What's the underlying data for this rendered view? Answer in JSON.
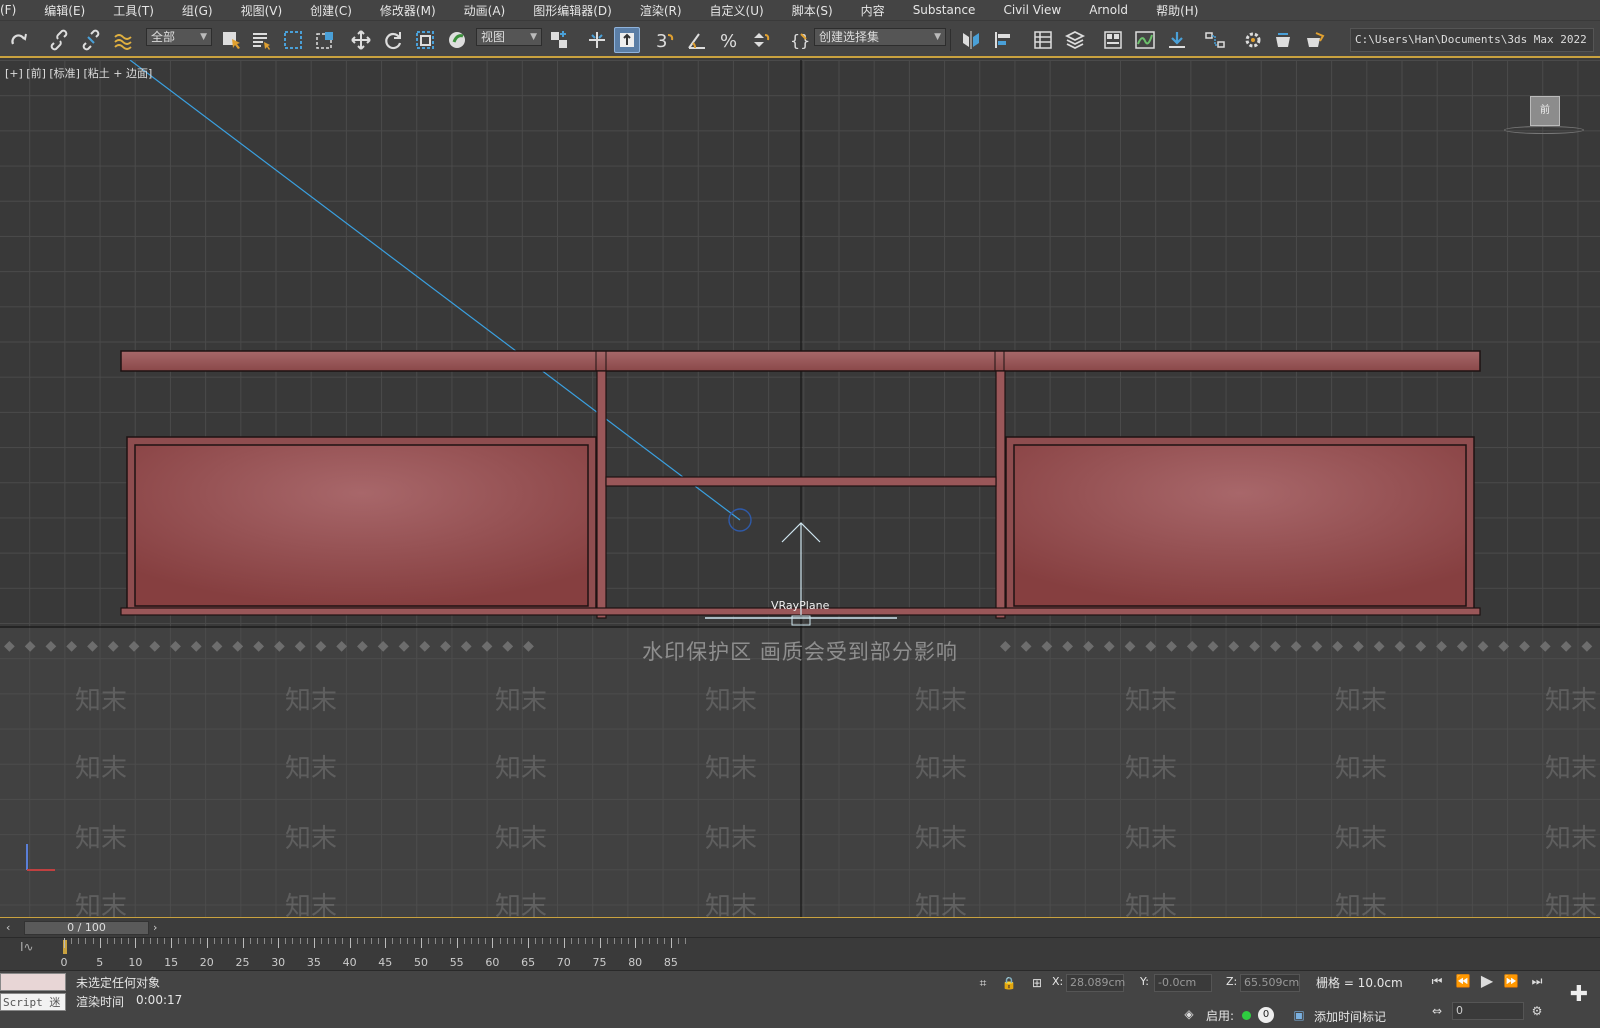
{
  "menu": [
    "(F)",
    "编辑(E)",
    "工具(T)",
    "组(G)",
    "视图(V)",
    "创建(C)",
    "修改器(M)",
    "动画(A)",
    "图形编辑器(D)",
    "渲染(R)",
    "自定义(U)",
    "脚本(S)",
    "内容",
    "Substance",
    "Civil View",
    "Arnold",
    "帮助(H)"
  ],
  "toolbar": {
    "filter_value": "全部",
    "view_value": "视图",
    "selection_set_placeholder": "创建选择集",
    "project_path": "C:\\Users\\Han\\Documents\\3ds Max 2022"
  },
  "viewport": {
    "label": "[+] [前] [标准] [粘土 + 边面]",
    "object_label": "VRayPlane",
    "viewcube_label": "前",
    "colors": {
      "furniture": "#8c4a4c",
      "furniture_edge": "#1e1212",
      "accent": "#c9a23f",
      "light_line": "#3aa0e0"
    }
  },
  "watermark": {
    "banner": "水印保护区  画质会受到部分影响",
    "tag": "知末"
  },
  "timeline": {
    "frame": "0 / 100",
    "ticks": [
      "0",
      "5",
      "10",
      "15",
      "20",
      "25",
      "30",
      "35",
      "40",
      "45",
      "50",
      "55",
      "60",
      "65",
      "70",
      "75",
      "80",
      "85"
    ]
  },
  "status": {
    "script_label": "Script 迷",
    "selection": "未选定任何对象",
    "render_time_label": "渲染时间",
    "render_time": "0:00:17",
    "x_label": "X:",
    "x_value": "28.089cm",
    "y_label": "Y:",
    "y_value": "-0.0cm",
    "z_label": "Z:",
    "z_value": "65.509cm",
    "grid": "栅格 = 10.0cm",
    "enable_label": "启用:",
    "enable_count": "0",
    "add_time_tag": "添加时间标记",
    "frame_field": "0"
  }
}
